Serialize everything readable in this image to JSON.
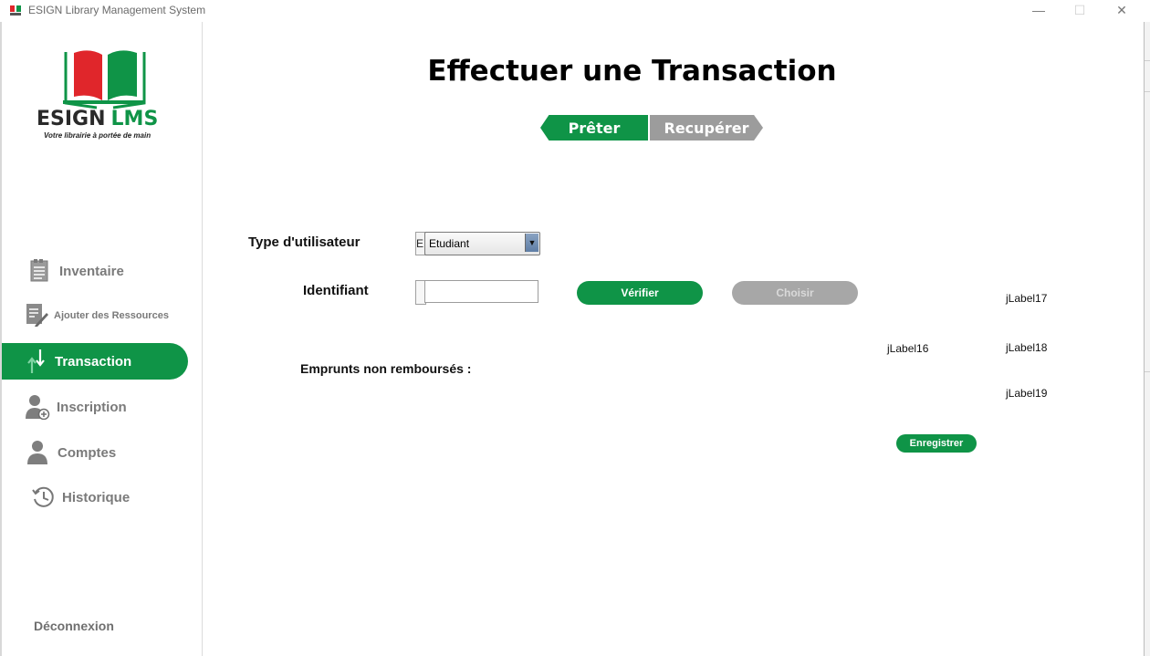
{
  "window": {
    "title": "ESIGN Library Management System",
    "minimize": "—",
    "maximize": "☐",
    "close": "✕"
  },
  "logo": {
    "brand_part1": "ESIGN",
    "brand_part2": "LMS",
    "tagline": "Votre librairie à portée de main",
    "colors": {
      "green": "#0f9447",
      "red": "#e0262b",
      "dark": "#2a2a2a"
    }
  },
  "sidebar": {
    "items": [
      {
        "label": "Inventaire",
        "icon": "document-list-icon",
        "active": false
      },
      {
        "label": "Ajouter des Ressources",
        "icon": "edit-document-icon",
        "active": false
      },
      {
        "label": "Transaction",
        "icon": "transfer-arrows-icon",
        "active": true
      },
      {
        "label": "Inscription",
        "icon": "add-user-icon",
        "active": false
      },
      {
        "label": "Comptes",
        "icon": "user-icon",
        "active": false
      },
      {
        "label": "Historique",
        "icon": "history-icon",
        "active": false
      }
    ],
    "logout": "Déconnexion"
  },
  "main": {
    "title": "Effectuer une Transaction",
    "segments": {
      "lend": "Prêter",
      "recover": "Recupérer"
    },
    "form": {
      "user_type_label": "Type d'utilisateur",
      "user_type_value": "Etudiant",
      "user_type_ghost": "E",
      "identifier_label": "Identifiant",
      "identifier_value": "",
      "verify_button": "Vérifier",
      "choose_button": "Choisir",
      "unpaid_label": "Emprunts non remboursés :",
      "save_button": "Enregistrer"
    },
    "labels": {
      "jLabel16": "jLabel16",
      "jLabel17": "jLabel17",
      "jLabel18": "jLabel18",
      "jLabel19": "jLabel19"
    }
  },
  "colors": {
    "accent": "#0f9447",
    "disabled": "#a7a7a7",
    "nav_text": "#7a7a7a"
  }
}
